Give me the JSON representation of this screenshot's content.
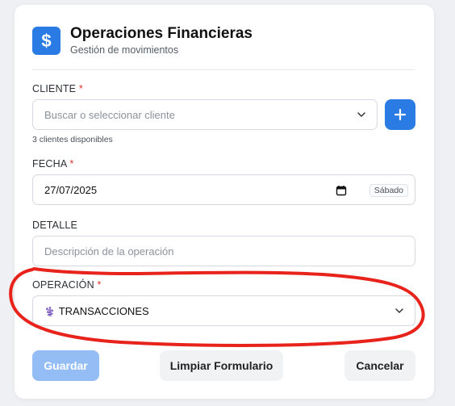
{
  "header": {
    "icon": "dollar-icon",
    "icon_glyph": "$",
    "title": "Operaciones Financieras",
    "subtitle": "Gestión de movimientos"
  },
  "cliente": {
    "label": "CLIENTE",
    "required_mark": "*",
    "placeholder": "Buscar o seleccionar cliente",
    "add_label": "+",
    "hint": "3 clientes disponibles"
  },
  "fecha": {
    "label": "FECHA",
    "required_mark": "*",
    "value": "27/07/2025",
    "weekday": "Sábado"
  },
  "detalle": {
    "label": "DETALLE",
    "placeholder": "Descripción de la operación"
  },
  "operacion": {
    "label": "OPERACIÓN",
    "required_mark": "*",
    "selected_icon": "⚕️",
    "selected": "TRANSACCIONES"
  },
  "actions": {
    "save_label": "Guardar",
    "clear_label": "Limpiar Formulario",
    "cancel_label": "Cancelar"
  },
  "colors": {
    "primary": "#2a7be4",
    "primary_disabled": "#93bdf4",
    "required": "#e2342c",
    "annotation": "#e8231b"
  }
}
